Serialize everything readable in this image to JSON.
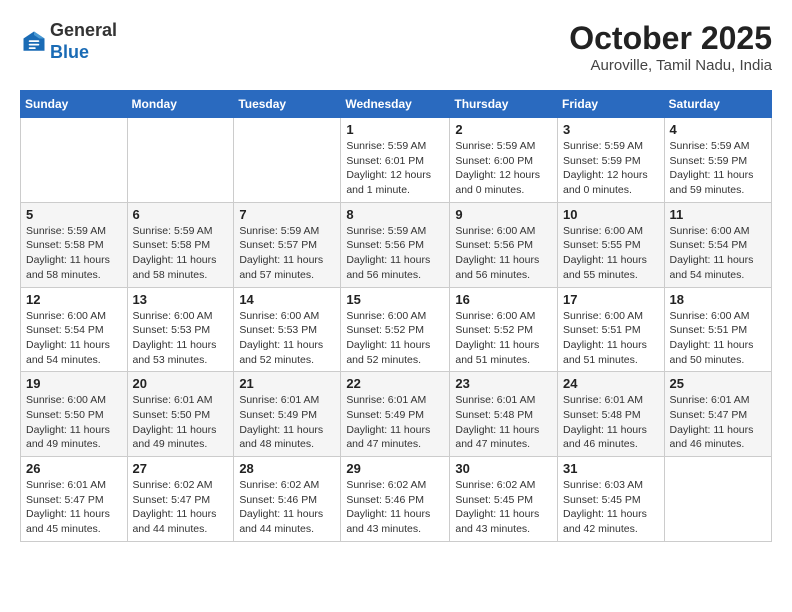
{
  "header": {
    "logo_general": "General",
    "logo_blue": "Blue",
    "month_title": "October 2025",
    "subtitle": "Auroville, Tamil Nadu, India"
  },
  "days_of_week": [
    "Sunday",
    "Monday",
    "Tuesday",
    "Wednesday",
    "Thursday",
    "Friday",
    "Saturday"
  ],
  "weeks": [
    [
      null,
      null,
      null,
      {
        "day": 1,
        "sunrise": "Sunrise: 5:59 AM",
        "sunset": "Sunset: 6:01 PM",
        "daylight": "Daylight: 12 hours and 1 minute."
      },
      {
        "day": 2,
        "sunrise": "Sunrise: 5:59 AM",
        "sunset": "Sunset: 6:00 PM",
        "daylight": "Daylight: 12 hours and 0 minutes."
      },
      {
        "day": 3,
        "sunrise": "Sunrise: 5:59 AM",
        "sunset": "Sunset: 5:59 PM",
        "daylight": "Daylight: 12 hours and 0 minutes."
      },
      {
        "day": 4,
        "sunrise": "Sunrise: 5:59 AM",
        "sunset": "Sunset: 5:59 PM",
        "daylight": "Daylight: 11 hours and 59 minutes."
      }
    ],
    [
      {
        "day": 5,
        "sunrise": "Sunrise: 5:59 AM",
        "sunset": "Sunset: 5:58 PM",
        "daylight": "Daylight: 11 hours and 58 minutes."
      },
      {
        "day": 6,
        "sunrise": "Sunrise: 5:59 AM",
        "sunset": "Sunset: 5:58 PM",
        "daylight": "Daylight: 11 hours and 58 minutes."
      },
      {
        "day": 7,
        "sunrise": "Sunrise: 5:59 AM",
        "sunset": "Sunset: 5:57 PM",
        "daylight": "Daylight: 11 hours and 57 minutes."
      },
      {
        "day": 8,
        "sunrise": "Sunrise: 5:59 AM",
        "sunset": "Sunset: 5:56 PM",
        "daylight": "Daylight: 11 hours and 56 minutes."
      },
      {
        "day": 9,
        "sunrise": "Sunrise: 6:00 AM",
        "sunset": "Sunset: 5:56 PM",
        "daylight": "Daylight: 11 hours and 56 minutes."
      },
      {
        "day": 10,
        "sunrise": "Sunrise: 6:00 AM",
        "sunset": "Sunset: 5:55 PM",
        "daylight": "Daylight: 11 hours and 55 minutes."
      },
      {
        "day": 11,
        "sunrise": "Sunrise: 6:00 AM",
        "sunset": "Sunset: 5:54 PM",
        "daylight": "Daylight: 11 hours and 54 minutes."
      }
    ],
    [
      {
        "day": 12,
        "sunrise": "Sunrise: 6:00 AM",
        "sunset": "Sunset: 5:54 PM",
        "daylight": "Daylight: 11 hours and 54 minutes."
      },
      {
        "day": 13,
        "sunrise": "Sunrise: 6:00 AM",
        "sunset": "Sunset: 5:53 PM",
        "daylight": "Daylight: 11 hours and 53 minutes."
      },
      {
        "day": 14,
        "sunrise": "Sunrise: 6:00 AM",
        "sunset": "Sunset: 5:53 PM",
        "daylight": "Daylight: 11 hours and 52 minutes."
      },
      {
        "day": 15,
        "sunrise": "Sunrise: 6:00 AM",
        "sunset": "Sunset: 5:52 PM",
        "daylight": "Daylight: 11 hours and 52 minutes."
      },
      {
        "day": 16,
        "sunrise": "Sunrise: 6:00 AM",
        "sunset": "Sunset: 5:52 PM",
        "daylight": "Daylight: 11 hours and 51 minutes."
      },
      {
        "day": 17,
        "sunrise": "Sunrise: 6:00 AM",
        "sunset": "Sunset: 5:51 PM",
        "daylight": "Daylight: 11 hours and 51 minutes."
      },
      {
        "day": 18,
        "sunrise": "Sunrise: 6:00 AM",
        "sunset": "Sunset: 5:51 PM",
        "daylight": "Daylight: 11 hours and 50 minutes."
      }
    ],
    [
      {
        "day": 19,
        "sunrise": "Sunrise: 6:00 AM",
        "sunset": "Sunset: 5:50 PM",
        "daylight": "Daylight: 11 hours and 49 minutes."
      },
      {
        "day": 20,
        "sunrise": "Sunrise: 6:01 AM",
        "sunset": "Sunset: 5:50 PM",
        "daylight": "Daylight: 11 hours and 49 minutes."
      },
      {
        "day": 21,
        "sunrise": "Sunrise: 6:01 AM",
        "sunset": "Sunset: 5:49 PM",
        "daylight": "Daylight: 11 hours and 48 minutes."
      },
      {
        "day": 22,
        "sunrise": "Sunrise: 6:01 AM",
        "sunset": "Sunset: 5:49 PM",
        "daylight": "Daylight: 11 hours and 47 minutes."
      },
      {
        "day": 23,
        "sunrise": "Sunrise: 6:01 AM",
        "sunset": "Sunset: 5:48 PM",
        "daylight": "Daylight: 11 hours and 47 minutes."
      },
      {
        "day": 24,
        "sunrise": "Sunrise: 6:01 AM",
        "sunset": "Sunset: 5:48 PM",
        "daylight": "Daylight: 11 hours and 46 minutes."
      },
      {
        "day": 25,
        "sunrise": "Sunrise: 6:01 AM",
        "sunset": "Sunset: 5:47 PM",
        "daylight": "Daylight: 11 hours and 46 minutes."
      }
    ],
    [
      {
        "day": 26,
        "sunrise": "Sunrise: 6:01 AM",
        "sunset": "Sunset: 5:47 PM",
        "daylight": "Daylight: 11 hours and 45 minutes."
      },
      {
        "day": 27,
        "sunrise": "Sunrise: 6:02 AM",
        "sunset": "Sunset: 5:47 PM",
        "daylight": "Daylight: 11 hours and 44 minutes."
      },
      {
        "day": 28,
        "sunrise": "Sunrise: 6:02 AM",
        "sunset": "Sunset: 5:46 PM",
        "daylight": "Daylight: 11 hours and 44 minutes."
      },
      {
        "day": 29,
        "sunrise": "Sunrise: 6:02 AM",
        "sunset": "Sunset: 5:46 PM",
        "daylight": "Daylight: 11 hours and 43 minutes."
      },
      {
        "day": 30,
        "sunrise": "Sunrise: 6:02 AM",
        "sunset": "Sunset: 5:45 PM",
        "daylight": "Daylight: 11 hours and 43 minutes."
      },
      {
        "day": 31,
        "sunrise": "Sunrise: 6:03 AM",
        "sunset": "Sunset: 5:45 PM",
        "daylight": "Daylight: 11 hours and 42 minutes."
      },
      null
    ]
  ]
}
